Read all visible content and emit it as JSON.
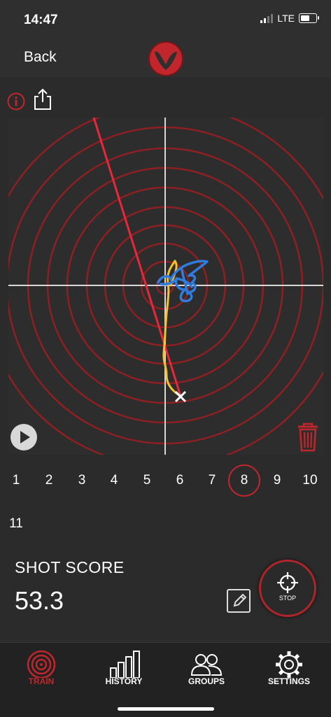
{
  "status": {
    "time": "14:47",
    "network": "LTE"
  },
  "nav": {
    "back_label": "Back"
  },
  "shots": {
    "items": [
      "1",
      "2",
      "3",
      "4",
      "5",
      "6",
      "7",
      "8",
      "9",
      "10",
      "11"
    ],
    "selected": "8"
  },
  "score": {
    "label": "SHOT SCORE",
    "value": "53.3"
  },
  "stop": {
    "label": "STOP"
  },
  "tabs": [
    {
      "label": "TRAIN",
      "icon": "target-icon",
      "active": true
    },
    {
      "label": "HISTORY",
      "icon": "bar-chart-icon",
      "active": false
    },
    {
      "label": "GROUPS",
      "icon": "people-icon",
      "active": false
    },
    {
      "label": "SETTINGS",
      "icon": "gear-icon",
      "active": false
    }
  ],
  "colors": {
    "accent": "#c0262b",
    "ring": "#8e1f22",
    "trace_blue": "#2f7de1",
    "trace_yellow": "#f2c230",
    "trace_red": "#e8283a"
  }
}
